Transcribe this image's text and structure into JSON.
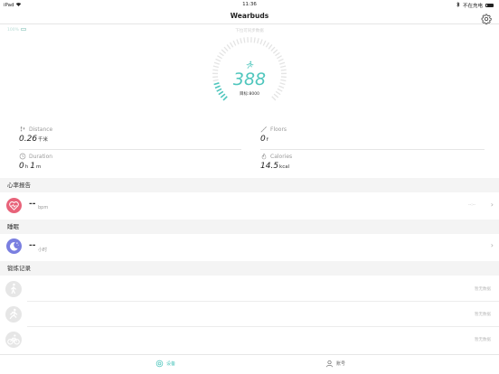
{
  "status_bar": {
    "device": "iPad",
    "time": "11:36",
    "charging": "不在充电"
  },
  "nav": {
    "title": "Wearbuds"
  },
  "device_battery": "100%",
  "sync_status": "下拉可同步数据",
  "steps": {
    "value": "388",
    "goal": "目标:8000",
    "progress": 0.0485
  },
  "stats": {
    "distance": {
      "label": "Distance",
      "value": "0.26",
      "unit": "千米"
    },
    "floors": {
      "label": "Floors",
      "value": "0",
      "unit": "f"
    },
    "duration": {
      "label": "Duration",
      "hours": "0",
      "h_unit": "h",
      "minutes": "1",
      "m_unit": "m"
    },
    "calories": {
      "label": "Calories",
      "value": "14.5",
      "unit": "kcal"
    }
  },
  "heart_rate": {
    "section": "心率报告",
    "value": "--",
    "unit": "bpm",
    "time": "--:--"
  },
  "sleep": {
    "section": "睡眠",
    "value": "--",
    "unit": "小时"
  },
  "exercise": {
    "section": "锻炼记录",
    "items": [
      {
        "icon": "walking-icon",
        "status": "暂无数据"
      },
      {
        "icon": "running-icon",
        "status": "暂无数据"
      },
      {
        "icon": "cycling-icon",
        "status": "暂无数据"
      }
    ]
  },
  "tabs": [
    {
      "label": "设备",
      "icon": "device-icon",
      "active": true
    },
    {
      "label": "账号",
      "icon": "account-icon",
      "active": false
    }
  ],
  "colors": {
    "accent": "#4fc6bd",
    "heart": "#e8637a",
    "sleep": "#7a7fe0"
  }
}
